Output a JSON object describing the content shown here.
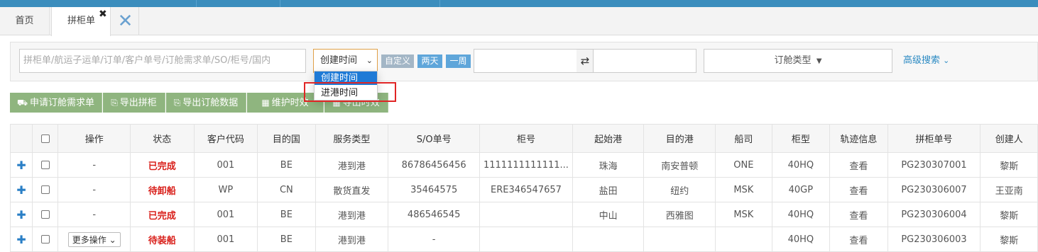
{
  "tabs": {
    "home": "首页",
    "active": "拼柜单",
    "close_glyph": "✖"
  },
  "search": {
    "keyword_placeholder": "拼柜单/航运子运单/订单/客户单号/订舱需求单/SO/柜号/国内",
    "date_type_selected": "创建时间",
    "quick_custom": "自定义",
    "quick_two_days": "两天",
    "quick_week": "一周",
    "booking_type": "订舱类型",
    "advanced": "高级搜索"
  },
  "date_type_dropdown": {
    "options": [
      "创建时间",
      "进港时间"
    ]
  },
  "toolbar": {
    "apply_booking": "申请订舱需求单",
    "export_consolidation": "导出拼柜",
    "export_booking_data": "导出订舱数据",
    "maintain_schedule": "维护时效",
    "export_schedule": "导出时效"
  },
  "table": {
    "headers": [
      "操作",
      "状态",
      "客户代码",
      "目的国",
      "服务类型",
      "S/O单号",
      "柜号",
      "起始港",
      "目的港",
      "船司",
      "柜型",
      "轨迹信息",
      "拼柜单号",
      "创建人"
    ],
    "rows": [
      {
        "op": "-",
        "status": "已完成",
        "customer": "001",
        "country": "BE",
        "service": "港到港",
        "so": "86786456456",
        "container": "1111111111111...",
        "origin": "珠海",
        "dest": "南安普顿",
        "carrier": "ONE",
        "type": "40HQ",
        "track": "查看",
        "order": "PG230307001",
        "creator": "黎斯"
      },
      {
        "op": "-",
        "status": "待卸船",
        "customer": "WP",
        "country": "CN",
        "service": "散货直发",
        "so": "35464575",
        "container": "ERE346547657",
        "origin": "盐田",
        "dest": "纽约",
        "carrier": "MSK",
        "type": "40GP",
        "track": "查看",
        "order": "PG230306007",
        "creator": "王亚南"
      },
      {
        "op": "-",
        "status": "已完成",
        "customer": "001",
        "country": "BE",
        "service": "港到港",
        "so": "486546545",
        "container": "",
        "origin": "中山",
        "dest": "西雅图",
        "carrier": "MSK",
        "type": "40HQ",
        "track": "查看",
        "order": "PG230306004",
        "creator": "黎斯"
      },
      {
        "op": "更多操作",
        "status": "待装船",
        "customer": "001",
        "country": "BE",
        "service": "港到港",
        "so": "-",
        "container": "",
        "origin": "",
        "dest": "",
        "carrier": "",
        "type": "40HQ",
        "track": "查看",
        "order": "PG230306003",
        "creator": "黎斯"
      }
    ]
  },
  "colors": {
    "status_red": "#d9201b",
    "link_blue": "#2b8ac3",
    "toolbar_green": "#8fb57f"
  }
}
